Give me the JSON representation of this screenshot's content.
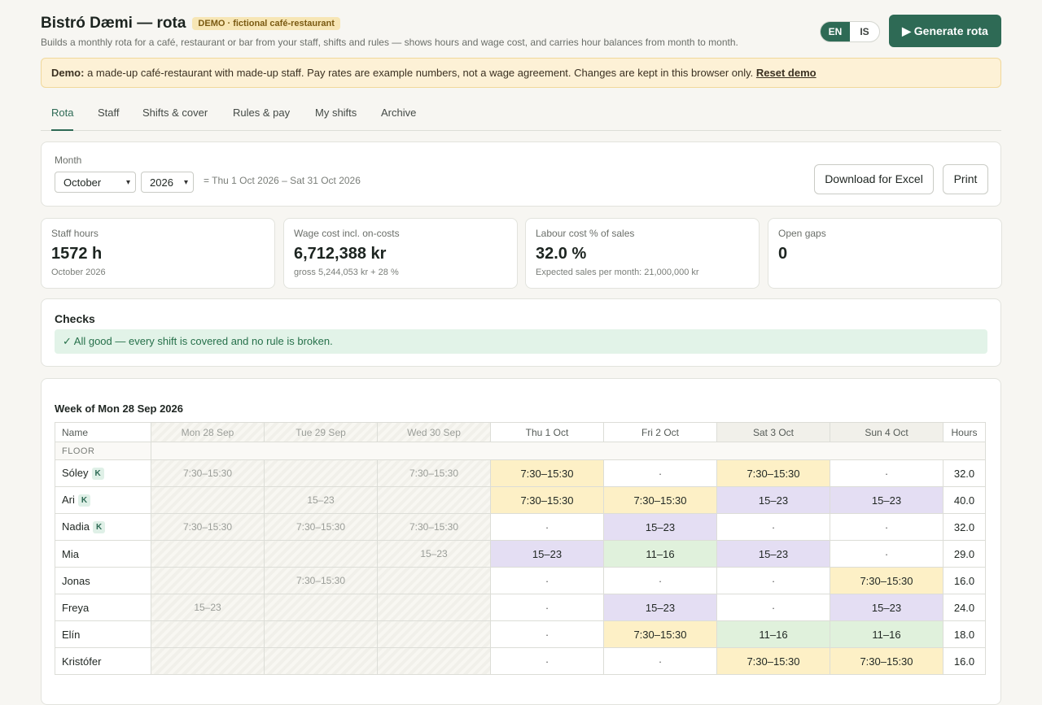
{
  "header": {
    "title": "Bistró Dæmi — rota",
    "badge": "DEMO · fictional café-restaurant",
    "subtitle": "Builds a monthly rota for a café, restaurant or bar from your staff, shifts and rules — shows hours and wage cost, and carries hour balances from month to month.",
    "lang_en": "EN",
    "lang_is": "IS",
    "generate_label": "▶ Generate rota"
  },
  "notice": {
    "lead": "Demo:",
    "text": " a made-up café-restaurant with made-up staff. Pay rates are example numbers, not a wage agreement. Changes are kept in this browser only. ",
    "reset": "Reset demo"
  },
  "tabs": [
    "Rota",
    "Staff",
    "Shifts & cover",
    "Rules & pay",
    "My shifts",
    "Archive"
  ],
  "month_panel": {
    "label": "Month",
    "month": "October",
    "year": "2026",
    "range": "= Thu 1 Oct 2026 – Sat 31 Oct 2026",
    "download": "Download for Excel",
    "print": "Print"
  },
  "kpis": [
    {
      "label": "Staff hours",
      "value": "1572 h",
      "sub": "October 2026"
    },
    {
      "label": "Wage cost incl. on-costs",
      "value": "6,712,388 kr",
      "sub": "gross 5,244,053 kr + 28 %"
    },
    {
      "label": "Labour cost % of sales",
      "value": "32.0 %",
      "sub": "Expected sales per month: 21,000,000 kr"
    },
    {
      "label": "Open gaps",
      "value": "0",
      "sub": ""
    }
  ],
  "checks": {
    "title": "Checks",
    "ok": "✓ All good — every shift is covered and no rule is broken."
  },
  "rota": {
    "week_title": "Week of Mon 28 Sep 2026",
    "name_header": "Name",
    "hours_header": "Hours",
    "days": [
      "Mon 28 Sep",
      "Tue 29 Sep",
      "Wed 30 Sep",
      "Thu 1 Oct",
      "Fri 2 Oct",
      "Sat 3 Oct",
      "Sun 4 Oct"
    ],
    "group": "FLOOR",
    "badge": "K",
    "rows": [
      {
        "name": "Sóley",
        "k": true,
        "cells": [
          "7:30–15:30",
          "",
          "7:30–15:30",
          "7:30–15:30",
          "·",
          "7:30–15:30",
          "·"
        ],
        "hours": "32.0"
      },
      {
        "name": "Ari",
        "k": true,
        "cells": [
          "",
          "15–23",
          "",
          "7:30–15:30",
          "7:30–15:30",
          "15–23",
          "15–23"
        ],
        "hours": "40.0"
      },
      {
        "name": "Nadia",
        "k": true,
        "cells": [
          "7:30–15:30",
          "7:30–15:30",
          "7:30–15:30",
          "·",
          "15–23",
          "·",
          "·"
        ],
        "hours": "32.0"
      },
      {
        "name": "Mia",
        "k": false,
        "cells": [
          "",
          "",
          "15–23",
          "15–23",
          "11–16",
          "15–23",
          "·"
        ],
        "hours": "29.0"
      },
      {
        "name": "Jonas",
        "k": false,
        "cells": [
          "",
          "7:30–15:30",
          "",
          "·",
          "·",
          "·",
          "7:30–15:30"
        ],
        "hours": "16.0"
      },
      {
        "name": "Freya",
        "k": false,
        "cells": [
          "15–23",
          "",
          "",
          "·",
          "15–23",
          "·",
          "15–23"
        ],
        "hours": "24.0"
      },
      {
        "name": "Elín",
        "k": false,
        "cells": [
          "",
          "",
          "",
          "·",
          "7:30–15:30",
          "11–16",
          "11–16"
        ],
        "hours": "18.0"
      },
      {
        "name": "Kristófer",
        "k": false,
        "cells": [
          "",
          "",
          "",
          "·",
          "·",
          "7:30–15:30",
          "7:30–15:30"
        ],
        "hours": "16.0"
      }
    ]
  }
}
